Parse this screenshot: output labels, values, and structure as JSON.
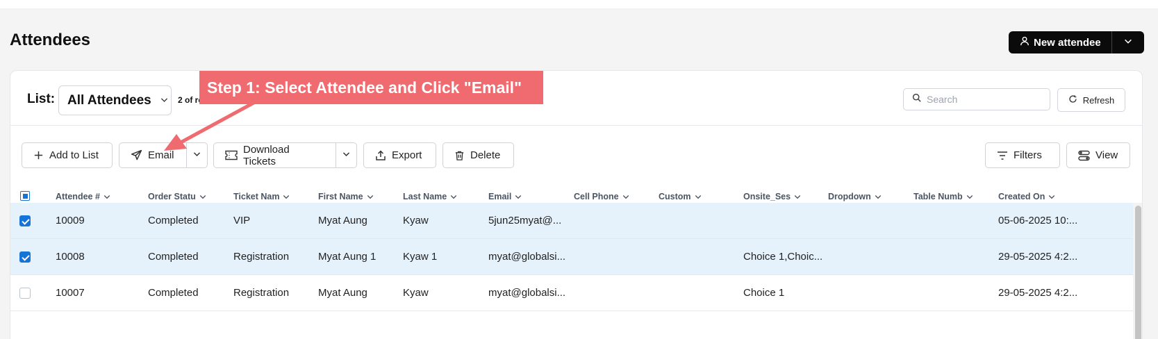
{
  "page": {
    "title": "Attendees"
  },
  "header": {
    "new_button_label": "New attendee"
  },
  "list_bar": {
    "label": "List:",
    "selected_list": "All Attendees",
    "records_text": "2 of re",
    "search_placeholder": "Search",
    "refresh_label": "Refresh"
  },
  "toolbar": {
    "add_to_list": "Add to List",
    "email": "Email",
    "download_tickets": "Download Tickets",
    "export": "Export",
    "delete": "Delete",
    "filters": "Filters",
    "view": "View"
  },
  "columns": [
    "Attendee #",
    "Order Statu",
    "Ticket Nam",
    "First Name",
    "Last Name",
    "Email",
    "Cell Phone",
    "Custom",
    "Onsite_Ses",
    "Dropdown",
    "Table Numb",
    "Created On"
  ],
  "rows": [
    {
      "selected": true,
      "cells": [
        "10009",
        "Completed",
        "VIP",
        "Myat Aung",
        "Kyaw",
        "5jun25myat@...",
        "",
        "",
        "",
        "",
        "",
        "05-06-2025 10:..."
      ]
    },
    {
      "selected": true,
      "cells": [
        "10008",
        "Completed",
        "Registration",
        "Myat Aung 1",
        "Kyaw 1",
        "myat@globalsi...",
        "",
        "",
        "Choice 1,Choic...",
        "",
        "",
        "29-05-2025 4:2..."
      ]
    },
    {
      "selected": false,
      "cells": [
        "10007",
        "Completed",
        "Registration",
        "Myat Aung",
        "Kyaw",
        "myat@globalsi...",
        "",
        "",
        "Choice 1",
        "",
        "",
        "29-05-2025 4:2..."
      ]
    }
  ],
  "annotation": {
    "text": "Step 1: Select Attendee and Click \"Email\"",
    "color": "#ef6b70"
  },
  "colors": {
    "accent": "#1673d8",
    "selected_row": "#e6f2fb",
    "primary_button": "#0b0b0b"
  }
}
